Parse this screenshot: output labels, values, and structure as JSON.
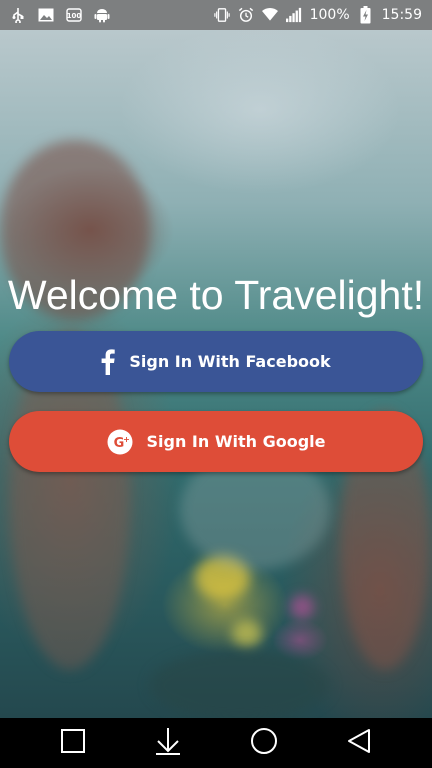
{
  "status_bar": {
    "battery_percent": "100%",
    "time": "15:59",
    "left_icons": [
      "usb-icon",
      "image-icon",
      "notification-100-icon",
      "android-icon"
    ],
    "right_icons": [
      "vibrate-icon",
      "alarm-icon",
      "wifi-icon",
      "signal-icon",
      "battery-charging-icon"
    ]
  },
  "welcome": {
    "title": "Welcome to Travelight!"
  },
  "buttons": {
    "facebook_label": "Sign In With Facebook",
    "google_label": "Sign In With Google",
    "facebook_color": "#3a5596",
    "google_color": "#de4d38"
  },
  "nav_bar": {
    "buttons": [
      "recent-apps-icon",
      "download-icon",
      "home-icon",
      "back-icon"
    ]
  }
}
